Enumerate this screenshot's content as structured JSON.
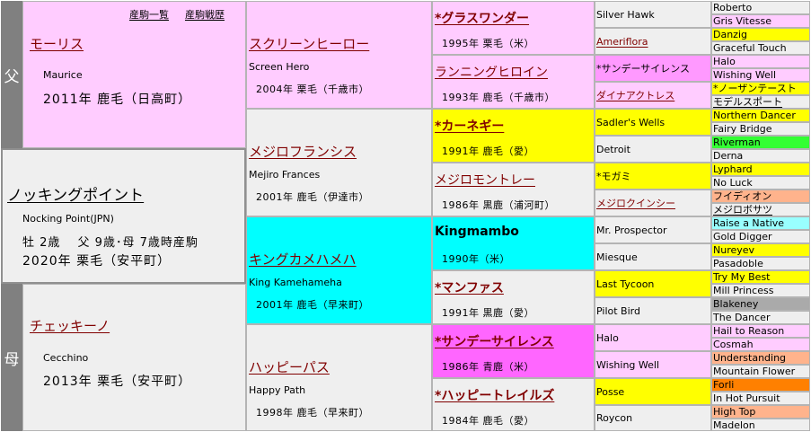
{
  "links": {
    "offspring": "産駒一覧",
    "race_record": "産駒戦歴"
  },
  "side_labels": {
    "sire": "父",
    "dam": "母"
  },
  "colors": {
    "pink": "#ffccff",
    "gray": "#efefef",
    "yellow": "#ffff00",
    "cyan": "#00ffff",
    "magenta": "#ff66ff",
    "orange": "#ffb38c",
    "green": "#33ff33",
    "lightcyan": "#99ffff",
    "darkgray": "#aaaaaa",
    "darkorange": "#ff8000"
  },
  "horse": {
    "name": "ノッキングポイント",
    "name_en": "Nocking Point(JPN)",
    "detail": "牡 2歳 　父 9歳･母 7歳時産駒",
    "birth": "2020年 栗毛（安平町）"
  },
  "sire": {
    "name": "モーリス",
    "name_en": "Maurice",
    "birth": "2011年 鹿毛（日高町）"
  },
  "dam": {
    "name": "チェッキーノ",
    "name_en": "Cecchino",
    "birth": "2013年 栗毛（安平町）"
  },
  "gen2": [
    {
      "name": "スクリーンヒーロー",
      "name_en": "Screen Hero",
      "info": "2004年 栗毛（千歳市）"
    },
    {
      "name": "メジロフランシス",
      "name_en": "Mejiro Frances",
      "info": "2001年 鹿毛（伊達市）"
    },
    {
      "name": "キングカメハメハ",
      "name_en": "King Kamehameha",
      "info": "2001年 鹿毛（早来町）"
    },
    {
      "name": "ハッピーパス",
      "name_en": "Happy Path",
      "info": "1998年 鹿毛（早来町）"
    }
  ],
  "gen3": [
    {
      "name": "*グラスワンダー",
      "info": "1995年 栗毛（米）"
    },
    {
      "name": "ランニングヒロイン",
      "info": "1993年 鹿毛（千歳市）"
    },
    {
      "name": "*カーネギー",
      "info": "1991年 鹿毛（愛）"
    },
    {
      "name": "メジロモントレー",
      "info": "1986年 黒鹿（浦河町）"
    },
    {
      "name": "Kingmambo",
      "info": "1990年（米）"
    },
    {
      "name": "*マンファス",
      "info": "1991年 黒鹿（愛）"
    },
    {
      "name": "*サンデーサイレンス",
      "info": "1986年 青鹿（米）"
    },
    {
      "name": "*ハッピートレイルズ",
      "info": "1984年 鹿毛（愛）"
    }
  ],
  "gen4": [
    "Silver Hawk",
    "Ameriflora",
    "*サンデーサイレンス",
    "ダイナアクトレス",
    "Sadler's Wells",
    "Detroit",
    "*モガミ",
    "メジロクインシー",
    "Mr. Prospector",
    "Miesque",
    "Last Tycoon",
    "Pilot Bird",
    "Halo",
    "Wishing Well",
    "Posse",
    "Roycon"
  ],
  "gen5": [
    "Roberto",
    "Gris Vitesse",
    "Danzig",
    "Graceful Touch",
    "Halo",
    "Wishing Well",
    "*ノーザンテースト",
    "モデルスポート",
    "Northern Dancer",
    "Fairy Bridge",
    "Riverman",
    "Derna",
    "Lyphard",
    "No Luck",
    "フイディオン",
    "メジロボサツ",
    "Raise a Native",
    "Gold Digger",
    "Nureyev",
    "Pasadoble",
    "Try My Best",
    "Mill Princess",
    "Blakeney",
    "The Dancer",
    "Hail to Reason",
    "Cosmah",
    "Understanding",
    "Mountain Flower",
    "Forli",
    "In Hot Pursuit",
    "High Top",
    "Madelon"
  ]
}
